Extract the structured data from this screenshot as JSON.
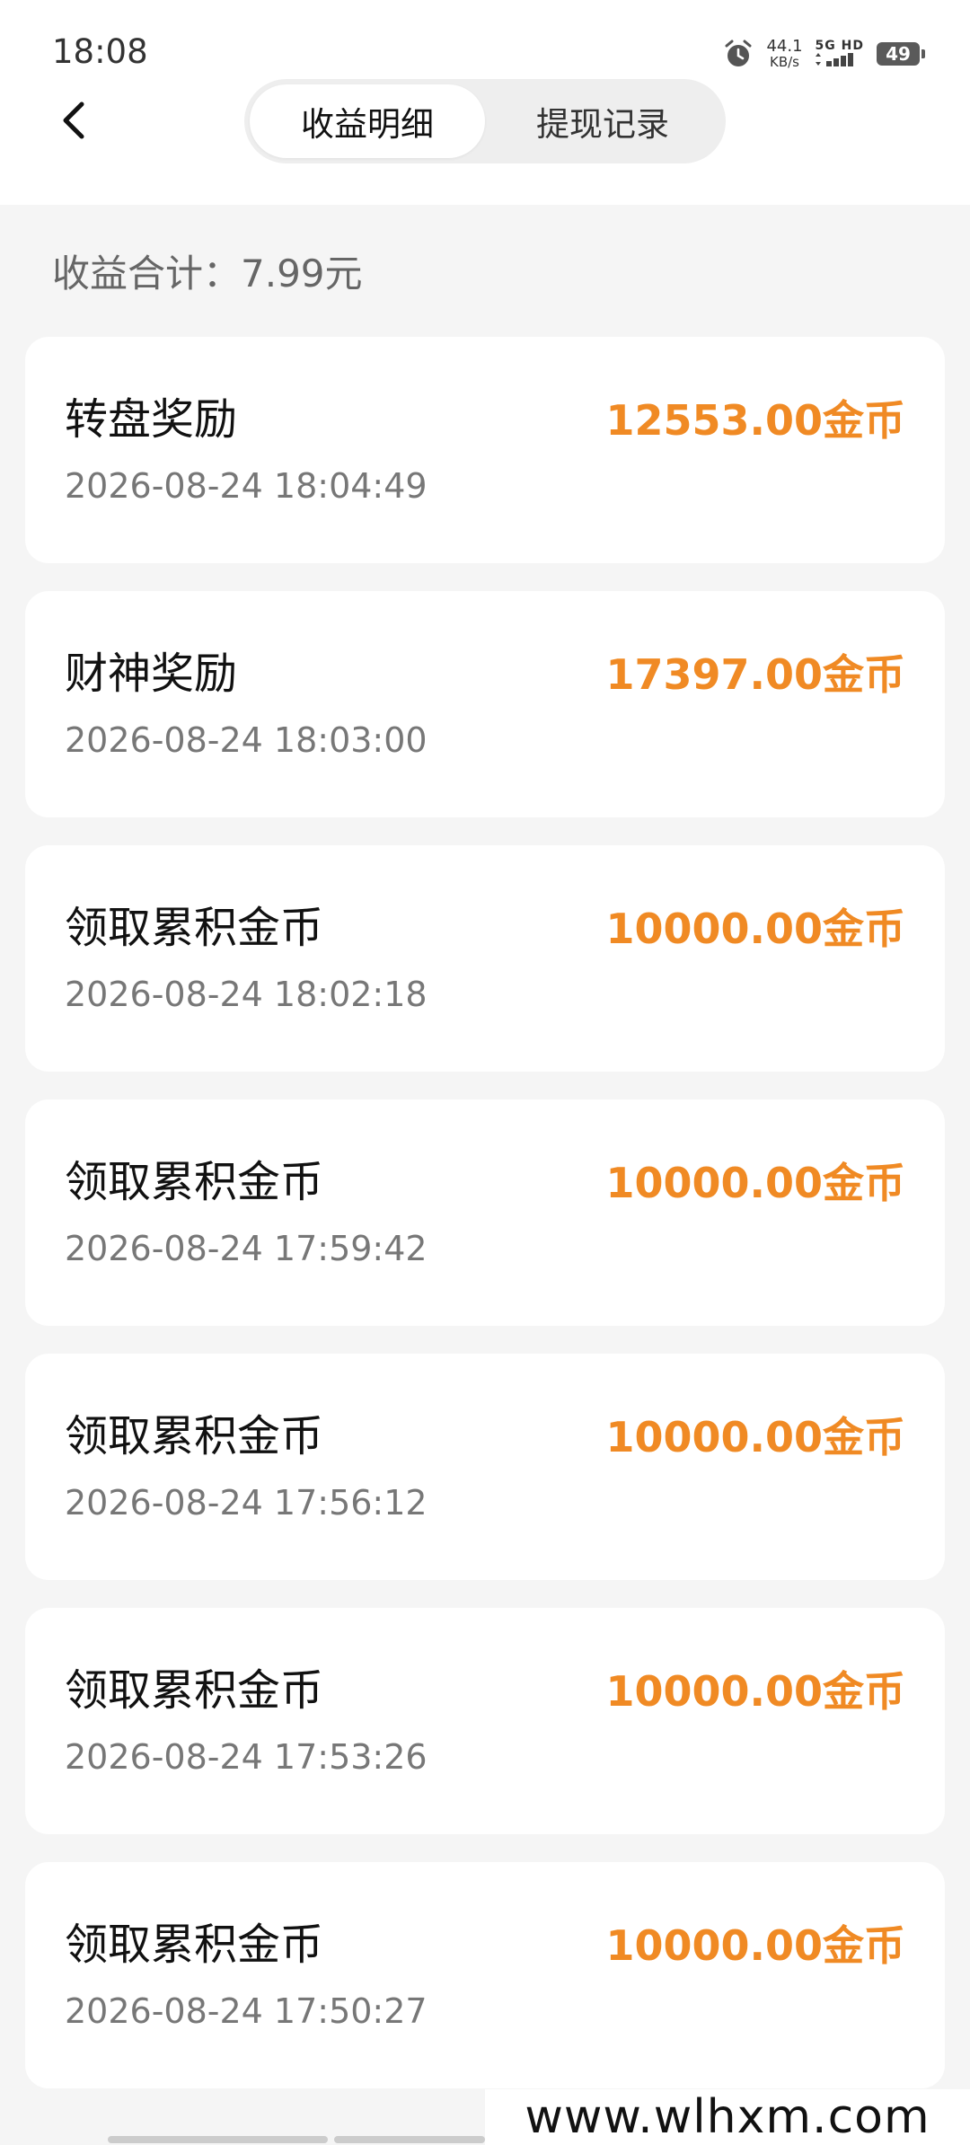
{
  "status_bar": {
    "time": "18:08",
    "net_speed_value": "44.1",
    "net_speed_unit": "KB/s",
    "signal_label": "5G HD",
    "battery": "49"
  },
  "header": {
    "tabs": [
      {
        "label": "收益明细",
        "active": true
      },
      {
        "label": "提现记录",
        "active": false
      }
    ]
  },
  "summary": {
    "text": "收益合计：7.99元"
  },
  "records": [
    {
      "title": "转盘奖励",
      "time": "2026-08-24 18:04:49",
      "amount": "12553.00金币"
    },
    {
      "title": "财神奖励",
      "time": "2026-08-24 18:03:00",
      "amount": "17397.00金币"
    },
    {
      "title": "领取累积金币",
      "time": "2026-08-24 18:02:18",
      "amount": "10000.00金币"
    },
    {
      "title": "领取累积金币",
      "time": "2026-08-24 17:59:42",
      "amount": "10000.00金币"
    },
    {
      "title": "领取累积金币",
      "time": "2026-08-24 17:56:12",
      "amount": "10000.00金币"
    },
    {
      "title": "领取累积金币",
      "time": "2026-08-24 17:53:26",
      "amount": "10000.00金币"
    },
    {
      "title": "领取累积金币",
      "time": "2026-08-24 17:50:27",
      "amount": "10000.00金币"
    }
  ],
  "colors": {
    "amount": "#f08a24",
    "background": "#f5f5f5",
    "card": "#ffffff"
  },
  "watermark": "www.wlhxm.com"
}
